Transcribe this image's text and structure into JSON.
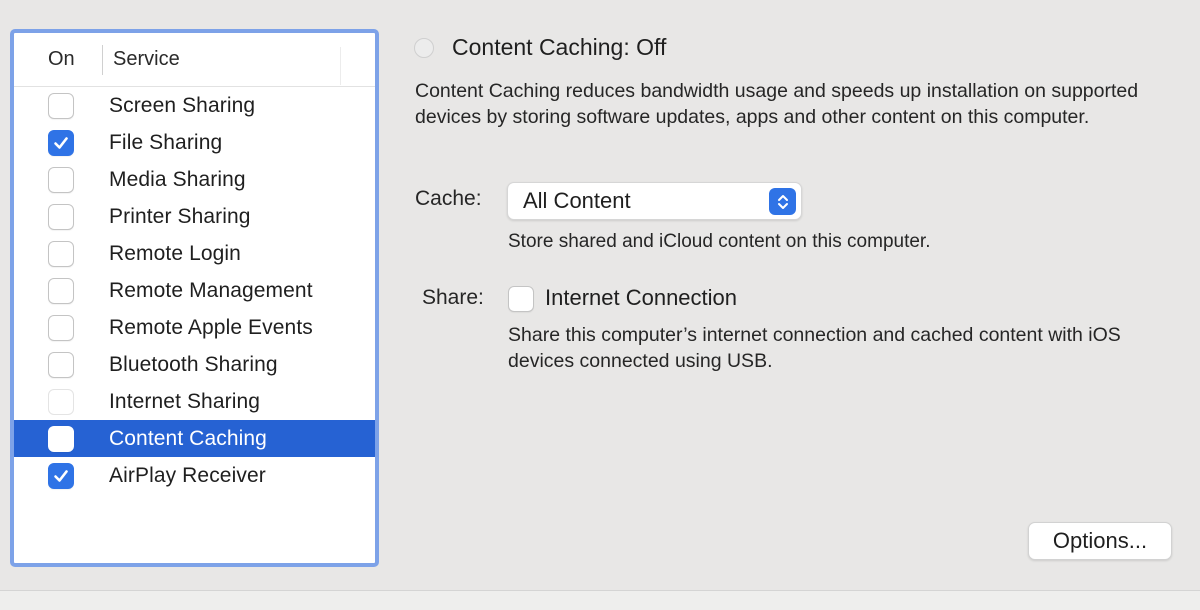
{
  "services_list": {
    "col_on": "On",
    "col_service": "Service",
    "items": [
      {
        "label": "Screen Sharing",
        "checked": false,
        "selected": false,
        "disabled": false
      },
      {
        "label": "File Sharing",
        "checked": true,
        "selected": false,
        "disabled": false
      },
      {
        "label": "Media Sharing",
        "checked": false,
        "selected": false,
        "disabled": false
      },
      {
        "label": "Printer Sharing",
        "checked": false,
        "selected": false,
        "disabled": false
      },
      {
        "label": "Remote Login",
        "checked": false,
        "selected": false,
        "disabled": false
      },
      {
        "label": "Remote Management",
        "checked": false,
        "selected": false,
        "disabled": false
      },
      {
        "label": "Remote Apple Events",
        "checked": false,
        "selected": false,
        "disabled": false
      },
      {
        "label": "Bluetooth Sharing",
        "checked": false,
        "selected": false,
        "disabled": false
      },
      {
        "label": "Internet Sharing",
        "checked": false,
        "selected": false,
        "disabled": true
      },
      {
        "label": "Content Caching",
        "checked": false,
        "selected": true,
        "disabled": false
      },
      {
        "label": "AirPlay Receiver",
        "checked": true,
        "selected": false,
        "disabled": false
      }
    ]
  },
  "detail": {
    "status_title": "Content Caching: Off",
    "description": "Content Caching reduces bandwidth usage and speeds up installation on supported devices by storing software updates, apps and other content on this computer.",
    "cache_label": "Cache:",
    "cache_value": "All Content",
    "cache_hint": "Store shared and iCloud content on this computer.",
    "share_label": "Share:",
    "share_option": "Internet Connection",
    "share_checked": false,
    "share_hint": "Share this computer’s internet connection and cached content with iOS devices connected using USB.",
    "options_button": "Options..."
  },
  "colors": {
    "accent": "#2f73e6",
    "selection": "#2662d3",
    "focus_ring": "#7da2e8",
    "background": "#e8e7e6"
  },
  "icons": {
    "checkmark": "checkmark-icon",
    "select_arrows": "up-down-chevron-icon",
    "status_indicator": "status-radio-icon"
  }
}
